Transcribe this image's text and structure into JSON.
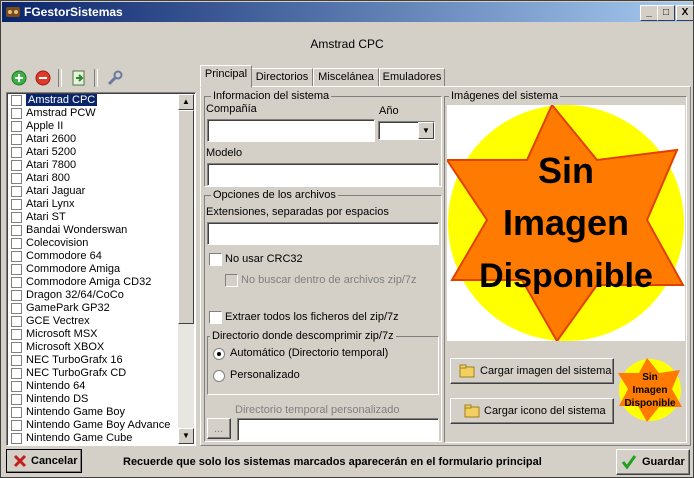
{
  "window": {
    "title": "FGestorSistemas",
    "controls": [
      "_",
      "□",
      "X"
    ]
  },
  "header": {
    "system_name": "Amstrad CPC"
  },
  "toolbar": {
    "icons": [
      "add-icon",
      "remove-icon",
      "import-icon",
      "wrench-icon"
    ]
  },
  "systems": [
    {
      "label": "Amstrad CPC",
      "selected": true
    },
    {
      "label": "Amstrad PCW"
    },
    {
      "label": "Apple II"
    },
    {
      "label": "Atari 2600"
    },
    {
      "label": "Atari 5200"
    },
    {
      "label": "Atari 7800"
    },
    {
      "label": "Atari 800"
    },
    {
      "label": "Atari Jaguar"
    },
    {
      "label": "Atari Lynx"
    },
    {
      "label": "Atari ST"
    },
    {
      "label": "Bandai Wonderswan"
    },
    {
      "label": "Colecovision"
    },
    {
      "label": "Commodore 64"
    },
    {
      "label": "Commodore Amiga"
    },
    {
      "label": "Commodore Amiga CD32"
    },
    {
      "label": "Dragon 32/64/CoCo"
    },
    {
      "label": "GamePark GP32"
    },
    {
      "label": "GCE Vectrex"
    },
    {
      "label": "Microsoft MSX"
    },
    {
      "label": "Microsoft XBOX"
    },
    {
      "label": "NEC TurboGrafx 16"
    },
    {
      "label": "NEC TurboGrafx CD"
    },
    {
      "label": "Nintendo 64"
    },
    {
      "label": "Nintendo DS"
    },
    {
      "label": "Nintendo Game Boy"
    },
    {
      "label": "Nintendo Game Boy Advance"
    },
    {
      "label": "Nintendo Game Cube"
    }
  ],
  "tabs": [
    "Principal",
    "Directorios",
    "Miscelánea",
    "Emuladores"
  ],
  "info": {
    "group_title": "Informacion del sistema",
    "company_label": "Compañía",
    "company_value": "",
    "year_label": "Año",
    "year_value": "",
    "model_label": "Modelo",
    "model_value": ""
  },
  "files": {
    "group_title": "Opciones de los archivos",
    "ext_label": "Extensiones, separadas por espacios",
    "ext_value": "",
    "no_crc_label": "No usar CRC32",
    "no_zip_search_label": "No buscar dentro de archivos zip/7z",
    "extract_all_label": "Extraer todos los ficheros del zip/7z",
    "unzip_dir_title": "Directorio donde descomprimir zip/7z",
    "auto_label": "Automático (Directorio temporal)",
    "custom_label": "Personalizado",
    "temp_dir_label": "Directorio temporal personalizado",
    "browse_label": "...",
    "temp_dir_value": ""
  },
  "images": {
    "group_title": "Imágenes del sistema",
    "placeholder_line1": "Sin",
    "placeholder_line2": "Imagen",
    "placeholder_line3": "Disponible",
    "load_image_label": "Cargar imagen del sistema",
    "load_icon_label": "Cargar icono del sistema",
    "icon_line1": "Sin",
    "icon_line2": "Imagen",
    "icon_line3": "Disponible"
  },
  "footer": {
    "cancel_label": "Cancelar",
    "message": "Recuerde que solo los sistemas marcados aparecerán en el formulario principal",
    "save_label": "Guardar"
  },
  "colors": {
    "title_start": "#0a246a",
    "title_end": "#a6caf0",
    "selection": "#0a246a",
    "star_fill": "#ff7a00",
    "sun_fill": "#ffff00"
  }
}
